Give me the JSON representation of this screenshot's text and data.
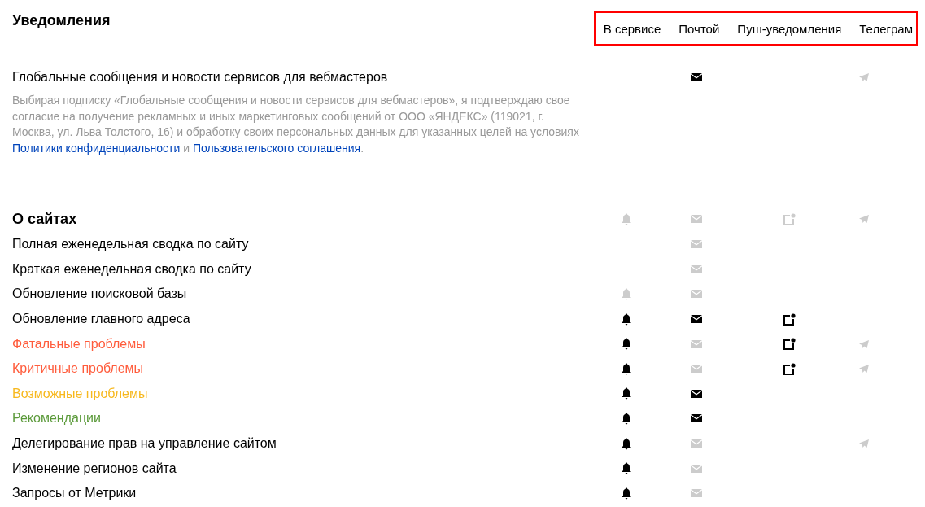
{
  "title": "Уведомления",
  "columns": [
    "В сервисе",
    "Почтой",
    "Пуш-уведомления",
    "Телеграм"
  ],
  "global": {
    "label": "Глобальные сообщения и новости сервисов для вебмастеров",
    "icons": {
      "email": {
        "kind": "mail",
        "on": true
      },
      "telegram": {
        "kind": "telegram",
        "on": false
      }
    },
    "consent": [
      {
        "kind": "text",
        "text": "Выбирая подписку «Глобальные сообщения и новости сервисов для вебмастеров», я подтверждаю свое согласие на получение рекламных и иных маркетинговых сообщений от ООО «ЯНДЕКС» (119021, г. Москва, ул. Льва Толстого, 16) и обработку своих персональных данных для указанных целей на условиях "
      },
      {
        "kind": "link",
        "text": "Политики конфиденциальности"
      },
      {
        "kind": "text",
        "text": " и "
      },
      {
        "kind": "link",
        "text": "Пользовательского соглашения"
      },
      {
        "kind": "text",
        "text": "."
      }
    ]
  },
  "section": {
    "label": "О сайтах",
    "icons": {
      "in_service": {
        "kind": "bell",
        "on": false
      },
      "email": {
        "kind": "mail",
        "on": false
      },
      "push": {
        "kind": "push",
        "on": false
      },
      "telegram": {
        "kind": "telegram",
        "on": false
      }
    },
    "rows": [
      {
        "label": "Полная еженедельная сводка по сайту",
        "icons": {
          "email": {
            "kind": "mail",
            "on": false
          }
        }
      },
      {
        "label": "Краткая еженедельная сводка по сайту",
        "icons": {
          "email": {
            "kind": "mail",
            "on": false
          }
        }
      },
      {
        "label": "Обновление поисковой базы",
        "icons": {
          "in_service": {
            "kind": "bell",
            "on": false
          },
          "email": {
            "kind": "mail",
            "on": false
          }
        }
      },
      {
        "label": "Обновление главного адреса",
        "icons": {
          "in_service": {
            "kind": "bell",
            "on": true
          },
          "email": {
            "kind": "mail",
            "on": true
          },
          "push": {
            "kind": "push",
            "on": true
          }
        }
      },
      {
        "label": "Фатальные проблемы",
        "color": "#ff5c3c",
        "icons": {
          "in_service": {
            "kind": "bell",
            "on": true
          },
          "email": {
            "kind": "mail",
            "on": false
          },
          "push": {
            "kind": "push",
            "on": true
          },
          "telegram": {
            "kind": "telegram",
            "on": false
          }
        }
      },
      {
        "label": "Критичные проблемы",
        "color": "#ff5c3c",
        "icons": {
          "in_service": {
            "kind": "bell",
            "on": true
          },
          "email": {
            "kind": "mail",
            "on": false
          },
          "push": {
            "kind": "push",
            "on": true
          },
          "telegram": {
            "kind": "telegram",
            "on": false
          }
        }
      },
      {
        "label": "Возможные проблемы",
        "color": "#f7b81e",
        "icons": {
          "in_service": {
            "kind": "bell",
            "on": true
          },
          "email": {
            "kind": "mail",
            "on": true
          }
        }
      },
      {
        "label": "Рекомендации",
        "color": "#5b9a3a",
        "icons": {
          "in_service": {
            "kind": "bell",
            "on": true
          },
          "email": {
            "kind": "mail",
            "on": true
          }
        }
      },
      {
        "label": "Делегирование прав на управление сайтом",
        "icons": {
          "in_service": {
            "kind": "bell",
            "on": true
          },
          "email": {
            "kind": "mail",
            "on": false
          },
          "telegram": {
            "kind": "telegram",
            "on": false
          }
        }
      },
      {
        "label": "Изменение регионов сайта",
        "icons": {
          "in_service": {
            "kind": "bell",
            "on": true
          },
          "email": {
            "kind": "mail",
            "on": false
          }
        }
      },
      {
        "label": "Запросы от Метрики",
        "icons": {
          "in_service": {
            "kind": "bell",
            "on": true
          },
          "email": {
            "kind": "mail",
            "on": false
          }
        }
      }
    ]
  }
}
